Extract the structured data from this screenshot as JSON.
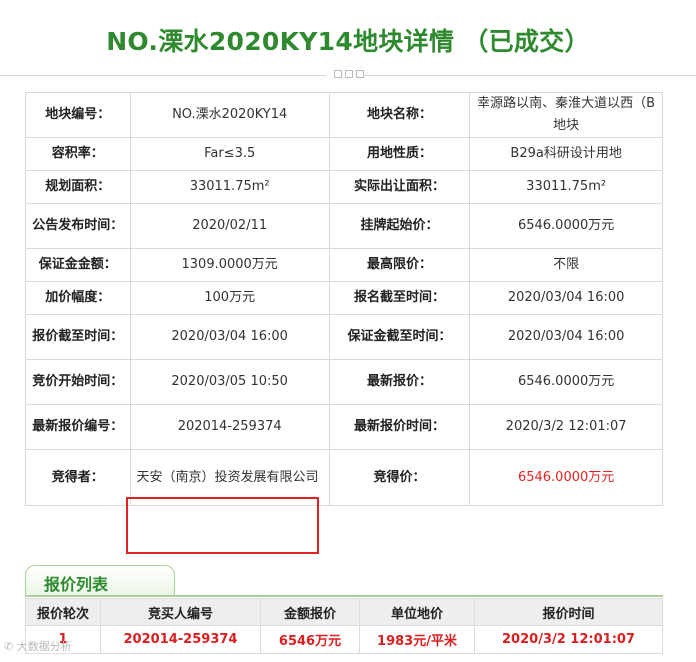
{
  "page": {
    "title": "NO.溧水2020KY14地块详情 （已成交）"
  },
  "details": {
    "rows": [
      [
        {
          "label": "地块编号：",
          "value": "NO.溧水2020KY14"
        },
        {
          "label": "地块名称：",
          "value": "幸源路以南、秦淮大道以西（B地块"
        }
      ],
      [
        {
          "label": "容积率：",
          "value": "Far≤3.5"
        },
        {
          "label": "用地性质：",
          "value": "B29a科研设计用地"
        }
      ],
      [
        {
          "label": "规划面积：",
          "value": "33011.75m²"
        },
        {
          "label": "实际出让面积：",
          "value": "33011.75m²"
        }
      ],
      [
        {
          "label": "公告发布时间：",
          "value": "2020/02/11"
        },
        {
          "label": "挂牌起始价：",
          "value": "6546.0000万元"
        }
      ],
      [
        {
          "label": "保证金金额：",
          "value": "1309.0000万元"
        },
        {
          "label": "最高限价：",
          "value": "不限"
        }
      ],
      [
        {
          "label": "加价幅度：",
          "value": "100万元"
        },
        {
          "label": "报名截至时间：",
          "value": "2020/03/04 16:00"
        }
      ],
      [
        {
          "label": "报价截至时间：",
          "value": "2020/03/04 16:00"
        },
        {
          "label": "保证金截至时间：",
          "value": "2020/03/04 16:00"
        }
      ],
      [
        {
          "label": "竞价开始时间：",
          "value": "2020/03/05 10:50"
        },
        {
          "label": "最新报价：",
          "value": "6546.0000万元"
        }
      ],
      [
        {
          "label": "最新报价编号：",
          "value": "202014-259374"
        },
        {
          "label": "最新报价时间：",
          "value": "2020/3/2 12:01:07"
        }
      ],
      [
        {
          "label": "竞得者：",
          "value": "天安（南京）投资发展有限公司"
        },
        {
          "label": "竞得价：",
          "value": "6546.0000万元"
        }
      ]
    ]
  },
  "bids": {
    "tab_label": "报价列表",
    "headers": [
      "报价轮次",
      "竞买人编号",
      "金额报价",
      "单位地价",
      "报价时间"
    ],
    "rows": [
      [
        "1",
        "202014-259374",
        "6546万元",
        "1983元/平米",
        "2020/3/2 12:01:07"
      ]
    ]
  },
  "watermark": "✆ 大数据分析",
  "colors": {
    "accent_green": "#2f8a2f",
    "highlight_red": "#e02222",
    "price_red": "#e52222"
  }
}
